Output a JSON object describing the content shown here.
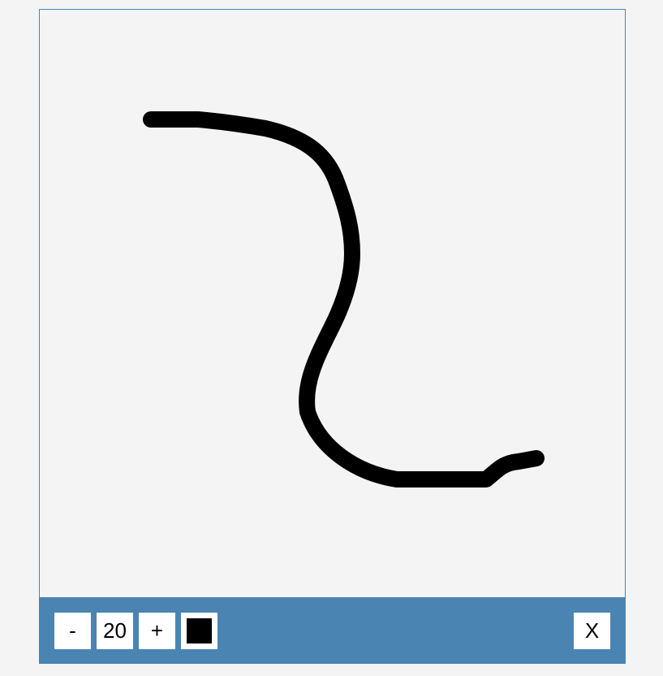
{
  "toolbar": {
    "minus_label": "-",
    "brush_size": "20",
    "plus_label": "+",
    "close_label": "X",
    "current_color": "#000000"
  },
  "theme": {
    "accent": "#4a84b3",
    "canvas_background": "#f4f4f5",
    "button_background": "#ffffff"
  }
}
